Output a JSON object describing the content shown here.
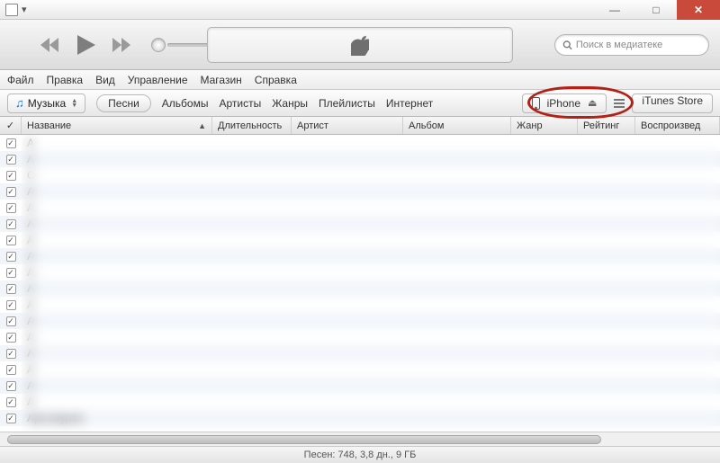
{
  "window": {
    "sysmenu_caret": "▾"
  },
  "winbuttons": {
    "min": "—",
    "max": "□",
    "close": "✕"
  },
  "search": {
    "placeholder": "Поиск в медиатеке"
  },
  "menubar": [
    "Файл",
    "Правка",
    "Вид",
    "Управление",
    "Магазин",
    "Справка"
  ],
  "navbar": {
    "library_label": "Музыка",
    "tabs": [
      "Песни",
      "Альбомы",
      "Артисты",
      "Жанры",
      "Плейлисты",
      "Интернет"
    ],
    "device_label": "iPhone",
    "store_label": "iTunes Store"
  },
  "columns": {
    "check": "✓",
    "name": "Название",
    "duration": "Длительность",
    "artist": "Артист",
    "album": "Альбом",
    "genre": "Жанр",
    "rating": "Рейтинг",
    "plays": "Воспроизвед"
  },
  "rows": [
    {
      "name": "A",
      "dur": "",
      "artist": "",
      "album": "",
      "genre": ""
    },
    {
      "name": "A",
      "dur": "",
      "artist": "",
      "album": "",
      "genre": ""
    },
    {
      "name": "C",
      "dur": "",
      "artist": "",
      "album": "",
      "genre": ""
    },
    {
      "name": "A",
      "dur": "",
      "artist": "",
      "album": "",
      "genre": ""
    },
    {
      "name": "A",
      "dur": "",
      "artist": "",
      "album": "",
      "genre": ""
    },
    {
      "name": "A",
      "dur": "",
      "artist": "",
      "album": "",
      "genre": ""
    },
    {
      "name": "A",
      "dur": "",
      "artist": "",
      "album": "",
      "genre": ""
    },
    {
      "name": "A",
      "dur": "",
      "artist": "",
      "album": "",
      "genre": ""
    },
    {
      "name": "A",
      "dur": "",
      "artist": "",
      "album": "",
      "genre": ""
    },
    {
      "name": "A",
      "dur": "",
      "artist": "",
      "album": "",
      "genre": ""
    },
    {
      "name": "A",
      "dur": "",
      "artist": "",
      "album": "",
      "genre": ""
    },
    {
      "name": "A",
      "dur": "",
      "artist": "",
      "album": "",
      "genre": ""
    },
    {
      "name": "A",
      "dur": "",
      "artist": "",
      "album": "",
      "genre": ""
    },
    {
      "name": "A",
      "dur": "",
      "artist": "",
      "album": "",
      "genre": ""
    },
    {
      "name": "A",
      "dur": "",
      "artist": "",
      "album": "",
      "genre": ""
    },
    {
      "name": "A",
      "dur": "",
      "artist": "",
      "album": "",
      "genre": ""
    },
    {
      "name": "A",
      "dur": "",
      "artist": "",
      "album": "",
      "genre": ""
    },
    {
      "name": "Apocalypsis",
      "dur": "",
      "artist": "",
      "album": "",
      "genre": ""
    }
  ],
  "status": "Песен: 748, 3,8 дн., 9 ГБ"
}
